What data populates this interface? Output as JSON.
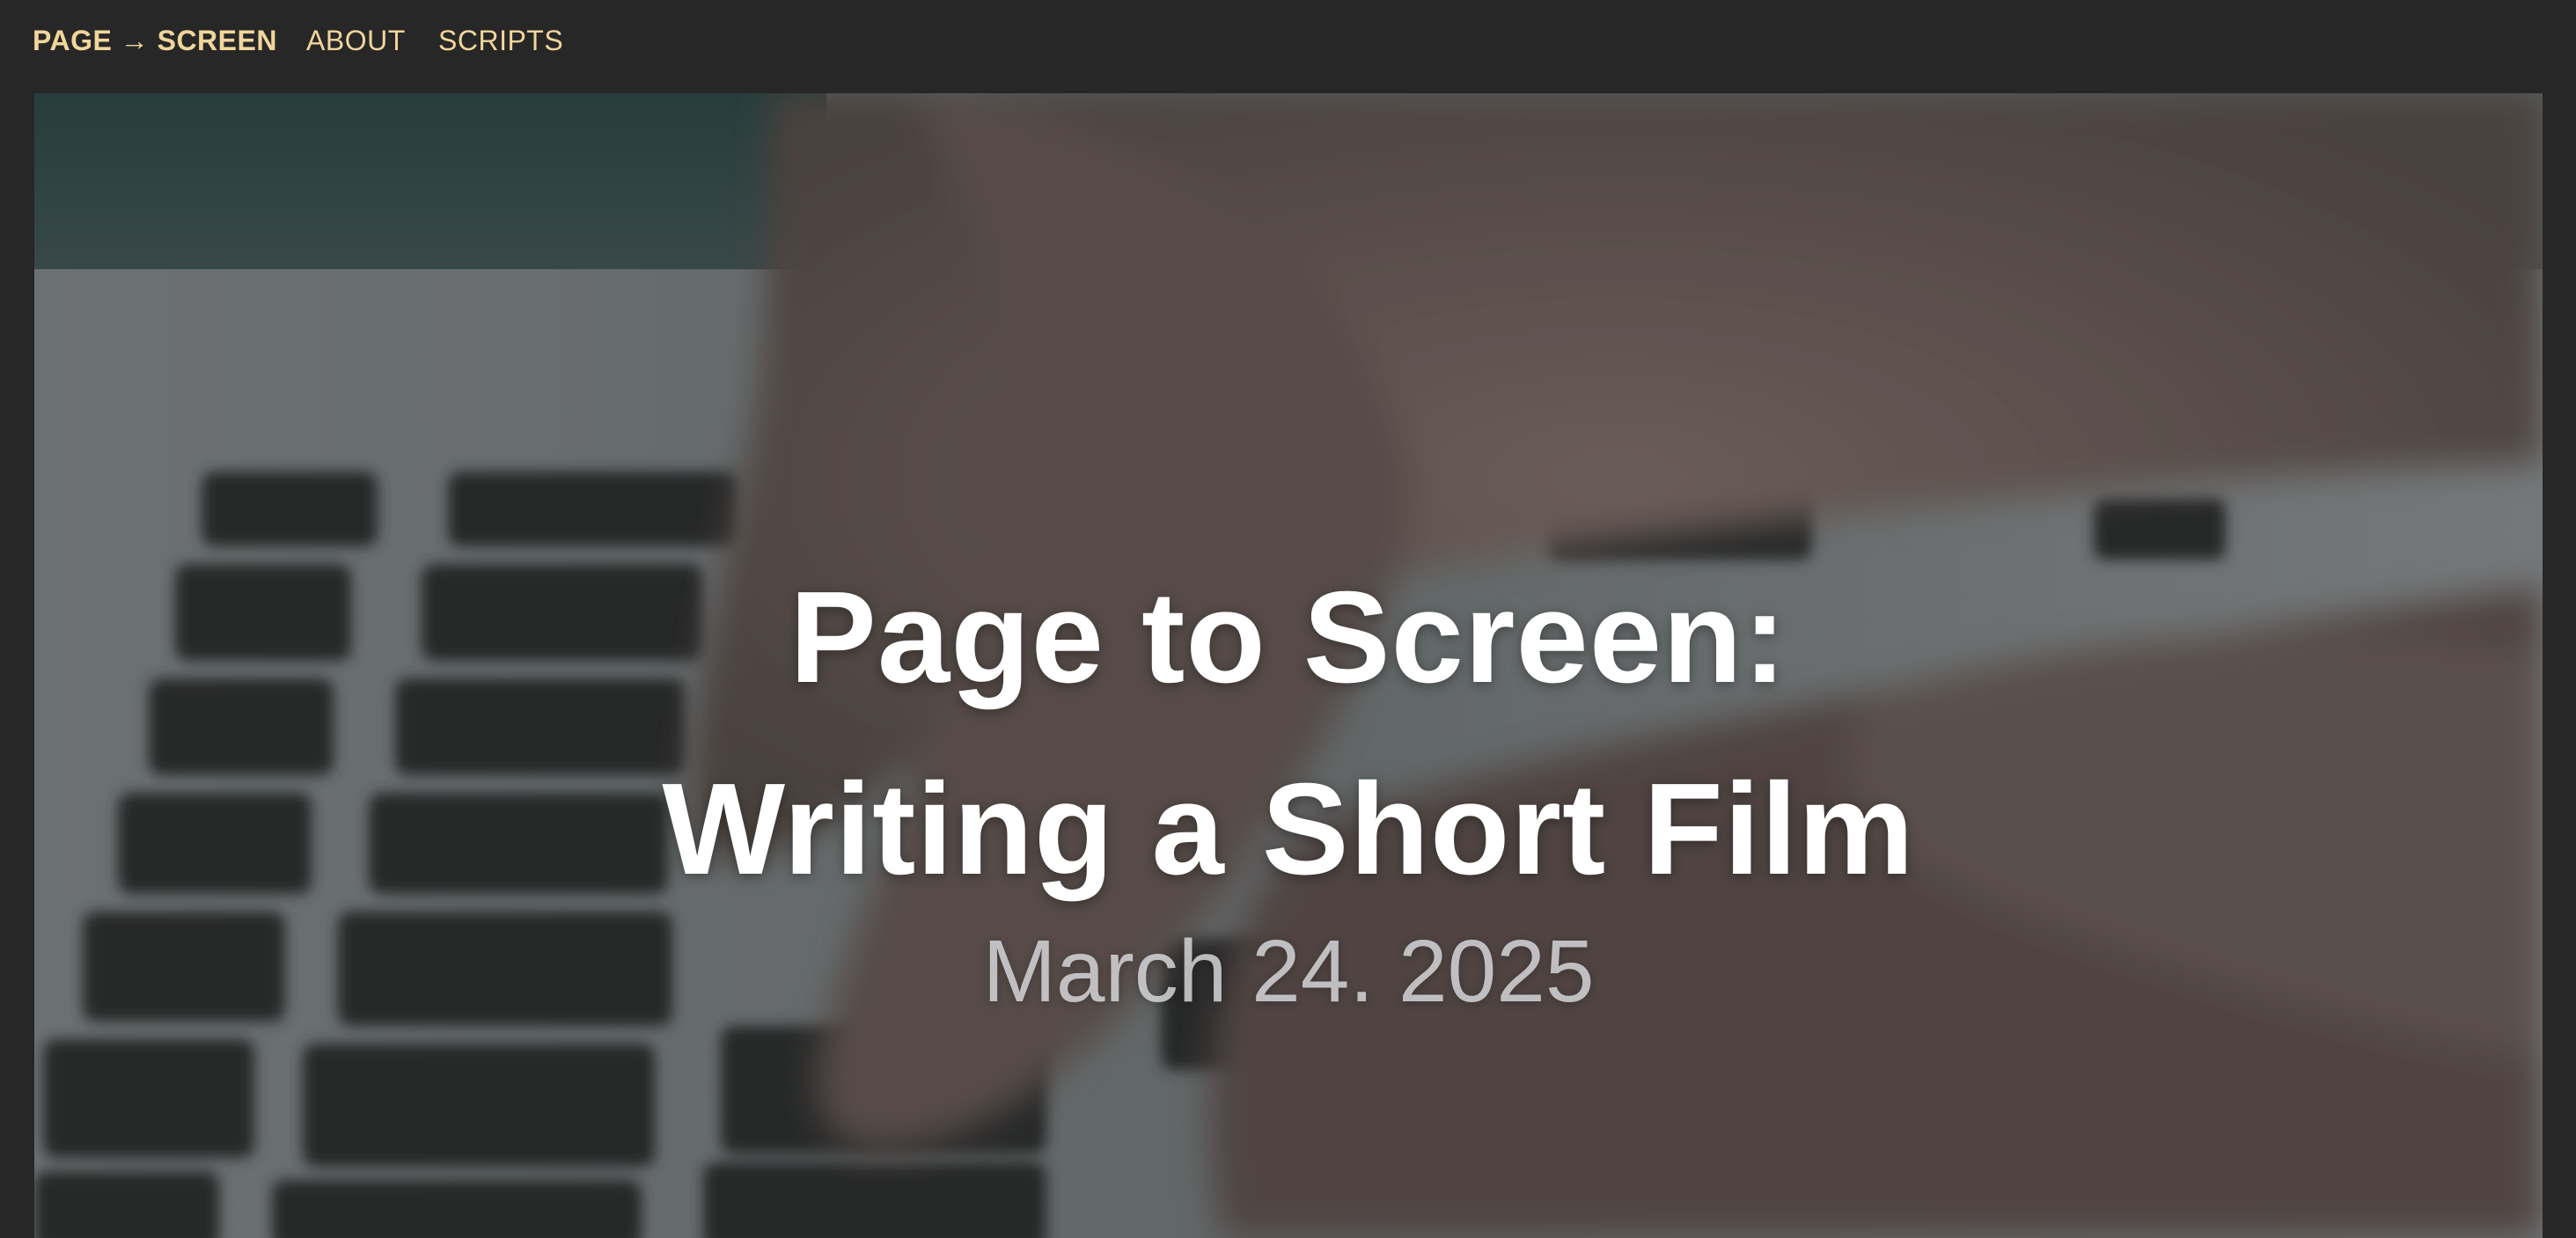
{
  "nav": {
    "brand": "PAGE → SCREEN",
    "items": [
      {
        "label": "ABOUT"
      },
      {
        "label": "SCRIPTS"
      }
    ]
  },
  "hero": {
    "title_line_1": "Page to Screen:",
    "title_line_2": "Writing a Short Film",
    "date": "March 24. 2025"
  },
  "colors": {
    "page_background": "#272727",
    "nav_text": "#f1d69b",
    "hero_title": "#ffffff",
    "hero_date": "#d1d1d3"
  }
}
